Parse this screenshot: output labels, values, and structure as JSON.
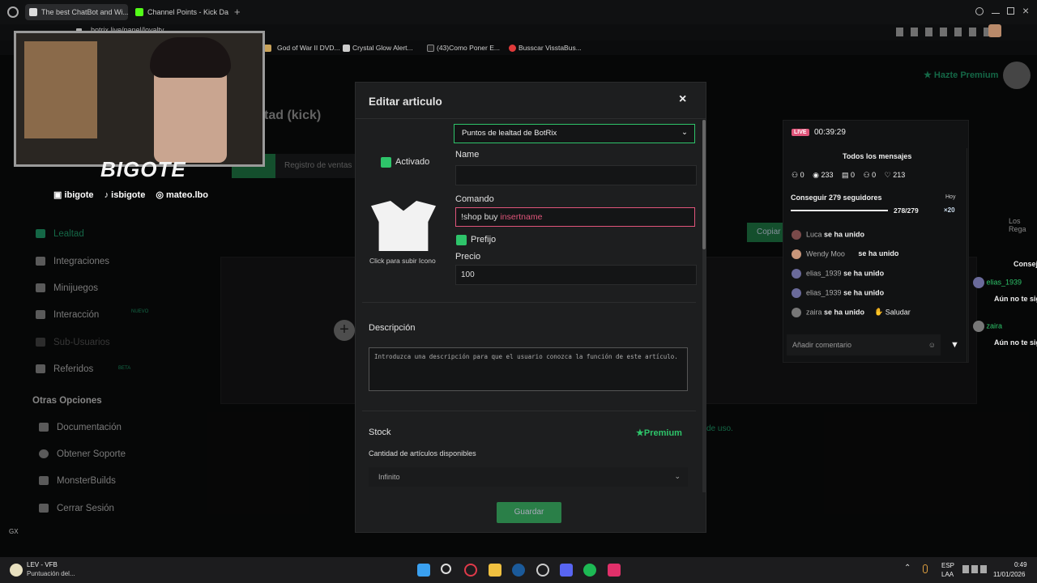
{
  "tabs": [
    {
      "label": "The best ChatBot and Wi..."
    },
    {
      "label": "Channel Points - Kick Das..."
    }
  ],
  "address": "botrix.live/panel/loyalty",
  "bookmarks": [
    {
      "label": "God of War II DVD..."
    },
    {
      "label": "Crystal Glow Alert..."
    },
    {
      "label": "(43)Como Poner E..."
    },
    {
      "label": "Busscar VisstaBus..."
    }
  ],
  "webcam": {
    "title": "BIGOTE",
    "handles": [
      "ibigote",
      "isbigote",
      "mateo.lbo"
    ]
  },
  "header": {
    "premium": "Hazte Premium",
    "page_title": "tad (kick)"
  },
  "sidebar": {
    "items": [
      {
        "label": "Lealtad"
      },
      {
        "label": "Integraciones"
      },
      {
        "label": "Minijuegos"
      },
      {
        "label": "Interacción",
        "badge": "NUEVO"
      },
      {
        "label": "Sub-Usuarios"
      },
      {
        "label": "Referidos",
        "badge": "BETA"
      }
    ],
    "section": "Otras Opciones",
    "options": [
      {
        "label": "Documentación"
      },
      {
        "label": "Obtener Soporte"
      },
      {
        "label": "MonsterBuilds"
      },
      {
        "label": "Cerrar Sesión"
      }
    ]
  },
  "bg": {
    "registro": "Registro de ventas",
    "copiar": "Copiar",
    "terms": "de uso."
  },
  "modal": {
    "title": "Editar articulo",
    "close": "×",
    "type_select": "Puntos de lealtad de BotRix",
    "activado": "Activado",
    "upload_label": "Click para subir Icono",
    "name_label": "Name",
    "name_value": "",
    "command_label": "Comando",
    "command_prefix": "!shop buy",
    "command_var": "insertname",
    "prefijo": "Prefijo",
    "price_label": "Precio",
    "price_value": "100",
    "desc_label": "Descripción",
    "desc_placeholder": "Introduzca una descripción para que el usuario conozca la función de este artículo.",
    "stock_label": "Stock",
    "premium": "Premium",
    "stock_sub": "Cantidad de artículos disponibles",
    "stock_value": "Infinito",
    "save": "Guardar"
  },
  "chat": {
    "live": "LIVE",
    "time": "00:39:29",
    "title": "Todos los mensajes",
    "stats": [
      "0",
      "233",
      "0",
      "0",
      "213"
    ],
    "goal": "Conseguir 279 seguidores",
    "goal_today": "Hoy",
    "goal_count": "278/279",
    "goal_mult": "×20",
    "goal_progress": 0.996,
    "messages": [
      {
        "user": "Luca",
        "text": "se ha unido"
      },
      {
        "user": "Wendy Moo",
        "text": "se ha unido"
      },
      {
        "user": "elias_1939",
        "text": "se ha unido"
      },
      {
        "user": "elias_1939",
        "text": "se ha unido"
      },
      {
        "user": "zaira",
        "text": "se ha unido",
        "extra": "Saludar"
      }
    ],
    "input_placeholder": "Añadir comentario",
    "side_users": [
      {
        "user": "elias_1939",
        "text": "Aún no te sig"
      },
      {
        "user": "zaira",
        "text": "Aún no te sig"
      }
    ],
    "side_title": "Consej",
    "los_regalos": "Los Rega"
  },
  "taskbar": {
    "weather_title": "LEV - VFB",
    "weather_sub": "Puntuación del...",
    "lang": "ESP",
    "lang2": "LAA",
    "time": "0:49",
    "date": "11/01/2026"
  },
  "colors": {
    "accent": "#2ec46a",
    "pink": "#e0557a"
  }
}
